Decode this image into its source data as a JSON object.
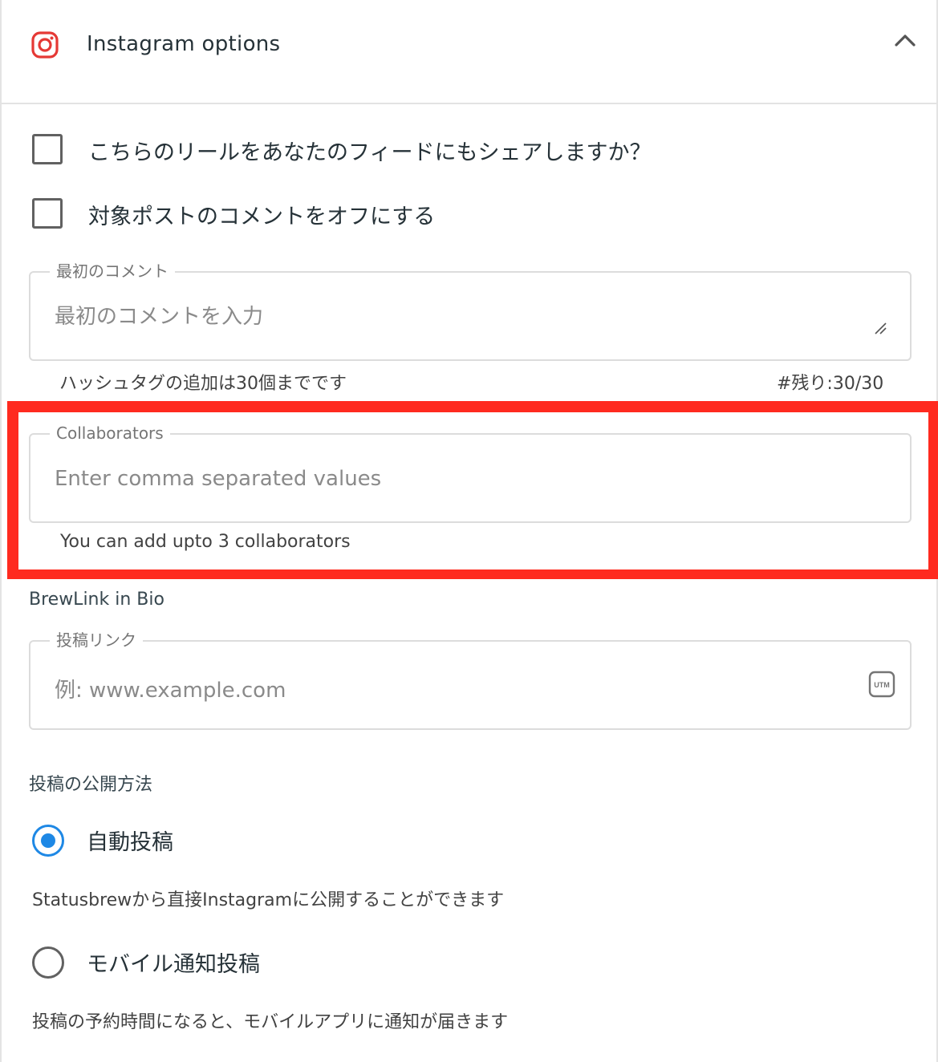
{
  "header": {
    "title": "Instagram options",
    "icon": "instagram-icon",
    "collapse_icon": "chevron-up-icon",
    "brand_color": "#e53935"
  },
  "checkboxes": [
    {
      "label": "こちらのリールをあなたのフィードにもシェアしますか？",
      "checked": false
    },
    {
      "label": "対象ポストのコメントをオフにする",
      "checked": false
    }
  ],
  "first_comment": {
    "label": "最初のコメント",
    "placeholder": "最初のコメントを入力",
    "helper": "ハッシュタグの追加は30個までです",
    "counter": "#残り:30/30"
  },
  "collaborators": {
    "label": "Collaborators",
    "placeholder": "Enter comma separated values",
    "helper": "You can add upto 3 collaborators",
    "highlight_color": "#ff2a1f"
  },
  "brewlink": {
    "section_label": "BrewLink in Bio",
    "label": "投稿リンク",
    "placeholder": "例: www.example.com",
    "utm_icon_text": "UTM"
  },
  "publish": {
    "section_label": "投稿の公開方法",
    "options": [
      {
        "label": "自動投稿",
        "description": "Statusbrewから直接Instagramに公開することができます",
        "selected": true
      },
      {
        "label": "モバイル通知投稿",
        "description": "投稿の予約時間になると、モバイルアプリに通知が届きます",
        "selected": false
      }
    ],
    "accent_color": "#1e88e5"
  }
}
